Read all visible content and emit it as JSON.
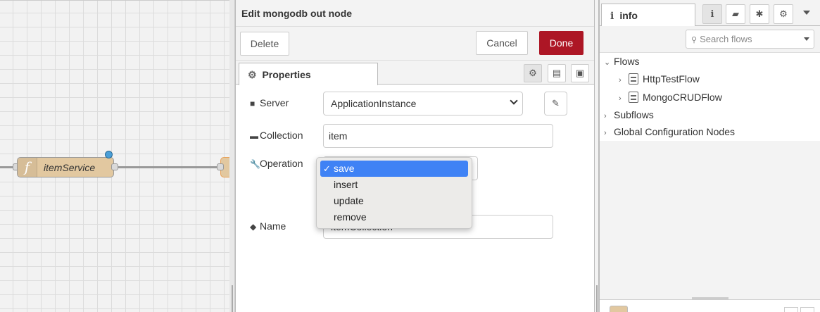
{
  "canvas": {
    "node_label": "itemService",
    "node_icon": "function-icon"
  },
  "tray": {
    "title": "Edit mongodb out node",
    "buttons": {
      "delete": "Delete",
      "cancel": "Cancel",
      "done": "Done"
    },
    "tab_label": "Properties",
    "fields": {
      "server": {
        "label": "Server",
        "value": "ApplicationInstance"
      },
      "collection": {
        "label": "Collection",
        "value": "item"
      },
      "operation": {
        "label": "Operation",
        "value": "save"
      },
      "name": {
        "label": "Name",
        "value": "itemCollection"
      }
    },
    "operation_options": [
      "save",
      "insert",
      "update",
      "remove"
    ],
    "selected_check": "✓"
  },
  "sidebar": {
    "tab_label": "info",
    "tab_icon_char": "i",
    "search_placeholder": "Search flows",
    "tree": {
      "flows_label": "Flows",
      "flows": [
        "HttpTestFlow",
        "MongoCRUDFlow"
      ],
      "subflows_label": "Subflows",
      "global_label": "Global Configuration Nodes"
    }
  },
  "colors": {
    "done": "#ad1625",
    "highlight": "#3f82f5",
    "node": "#e2c8a0",
    "status": "#4a9fd8"
  }
}
